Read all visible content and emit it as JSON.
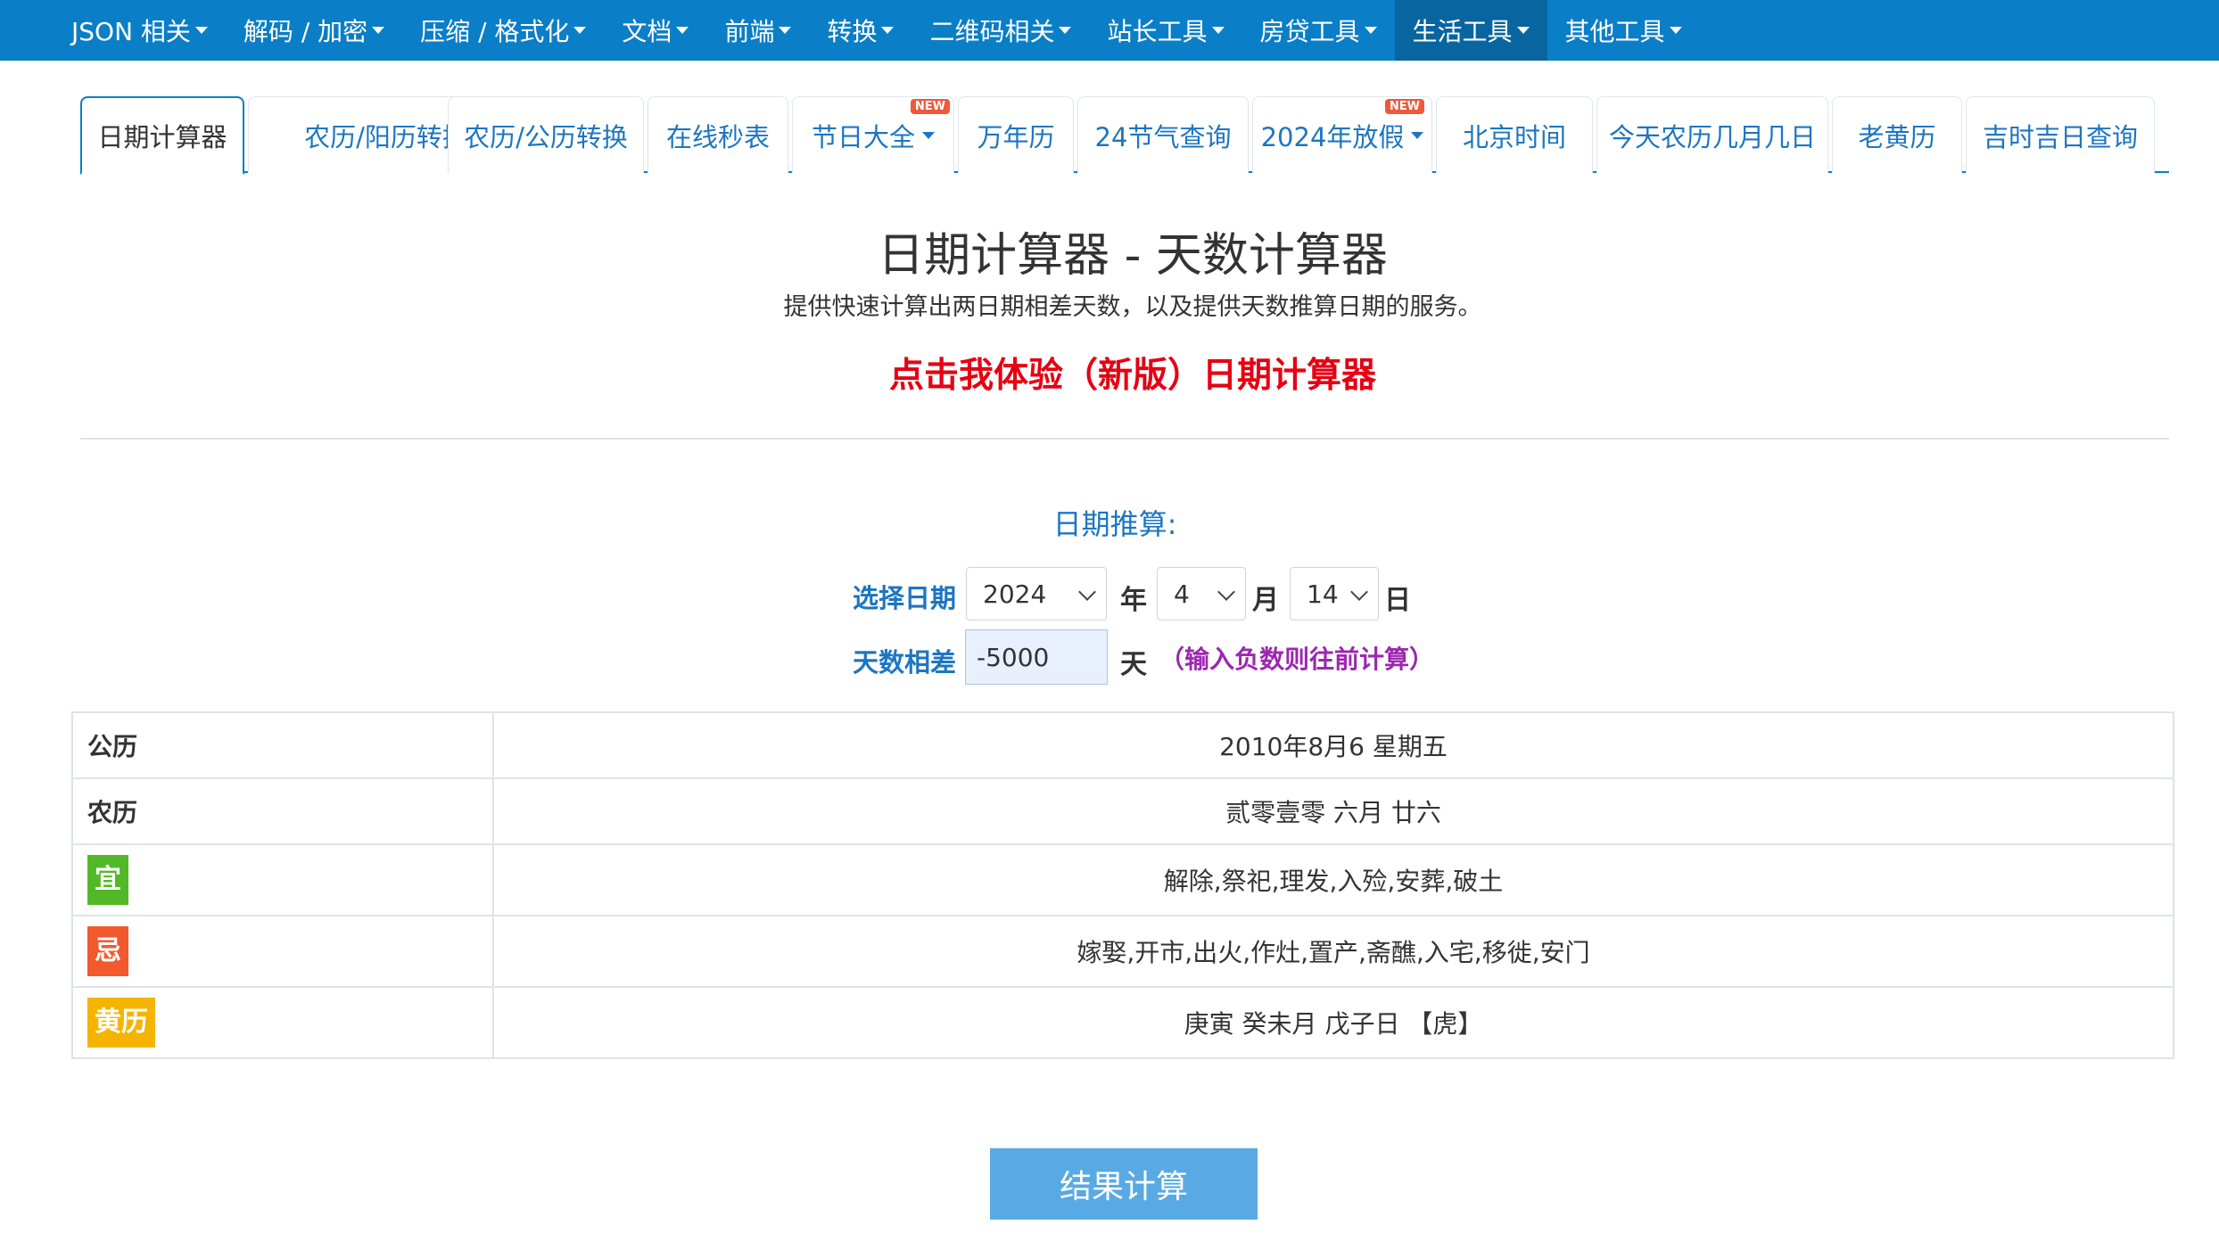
{
  "topnav": {
    "items": [
      {
        "label": "JSON 相关"
      },
      {
        "label": "解码 / 加密"
      },
      {
        "label": "压缩 / 格式化"
      },
      {
        "label": "文档"
      },
      {
        "label": "前端"
      },
      {
        "label": "转换"
      },
      {
        "label": "二维码相关"
      },
      {
        "label": "站长工具"
      },
      {
        "label": "房贷工具"
      },
      {
        "label": "生活工具"
      },
      {
        "label": "其他工具"
      }
    ]
  },
  "tabs": [
    {
      "label": "日期计算器"
    },
    {
      "label": "农历/阳历转换"
    },
    {
      "label": "农历/公历转换"
    },
    {
      "label": "在线秒表"
    },
    {
      "label": "节日大全",
      "badge": "NEW"
    },
    {
      "label": "万年历"
    },
    {
      "label": "24节气查询"
    },
    {
      "label": "2024年放假",
      "badge": "NEW"
    },
    {
      "label": "北京时间"
    },
    {
      "label": "今天农历几月几日"
    },
    {
      "label": "老黄历"
    },
    {
      "label": "吉时吉日查询"
    }
  ],
  "page": {
    "title": "日期计算器 - 天数计算器",
    "subtitle": "提供快速计算出两日期相差天数，以及提供天数推算日期的服务。",
    "promo": "点击我体验（新版）日期计算器"
  },
  "form": {
    "section_label": "日期推算:",
    "select_date_label": "选择日期",
    "year_value": "2024",
    "year_unit": "年",
    "month_value": "4",
    "month_unit": "月",
    "day_value": "14",
    "day_unit": "日",
    "days_diff_label": "天数相差",
    "days_diff_value": "-5000",
    "days_unit": "天",
    "hint": "（输入负数则往前计算）"
  },
  "result": {
    "gregorian_label": "公历",
    "gregorian_value": "2010年8月6 星期五",
    "lunar_label": "农历",
    "lunar_value": "贰零壹零 六月 廿六",
    "yi_label": "宜",
    "yi_value": "解除,祭祀,理发,入殓,安葬,破土",
    "ji_label": "忌",
    "ji_value": "嫁娶,开市,出火,作灶,置产,斋醮,入宅,移徙,安门",
    "huangli_label": "黄历",
    "huangli_value": "庚寅 癸未月 戊子日 【虎】"
  },
  "colors": {
    "nav_bg": "#0a7ec6",
    "accent": "#1d76c0",
    "promo": "#e60012",
    "hint": "#9c27b0",
    "yi": "#52b827",
    "ji": "#f2592d",
    "huangli": "#f5b400",
    "button": "#59a9e4"
  },
  "button": {
    "calc_label": "结果计算"
  }
}
